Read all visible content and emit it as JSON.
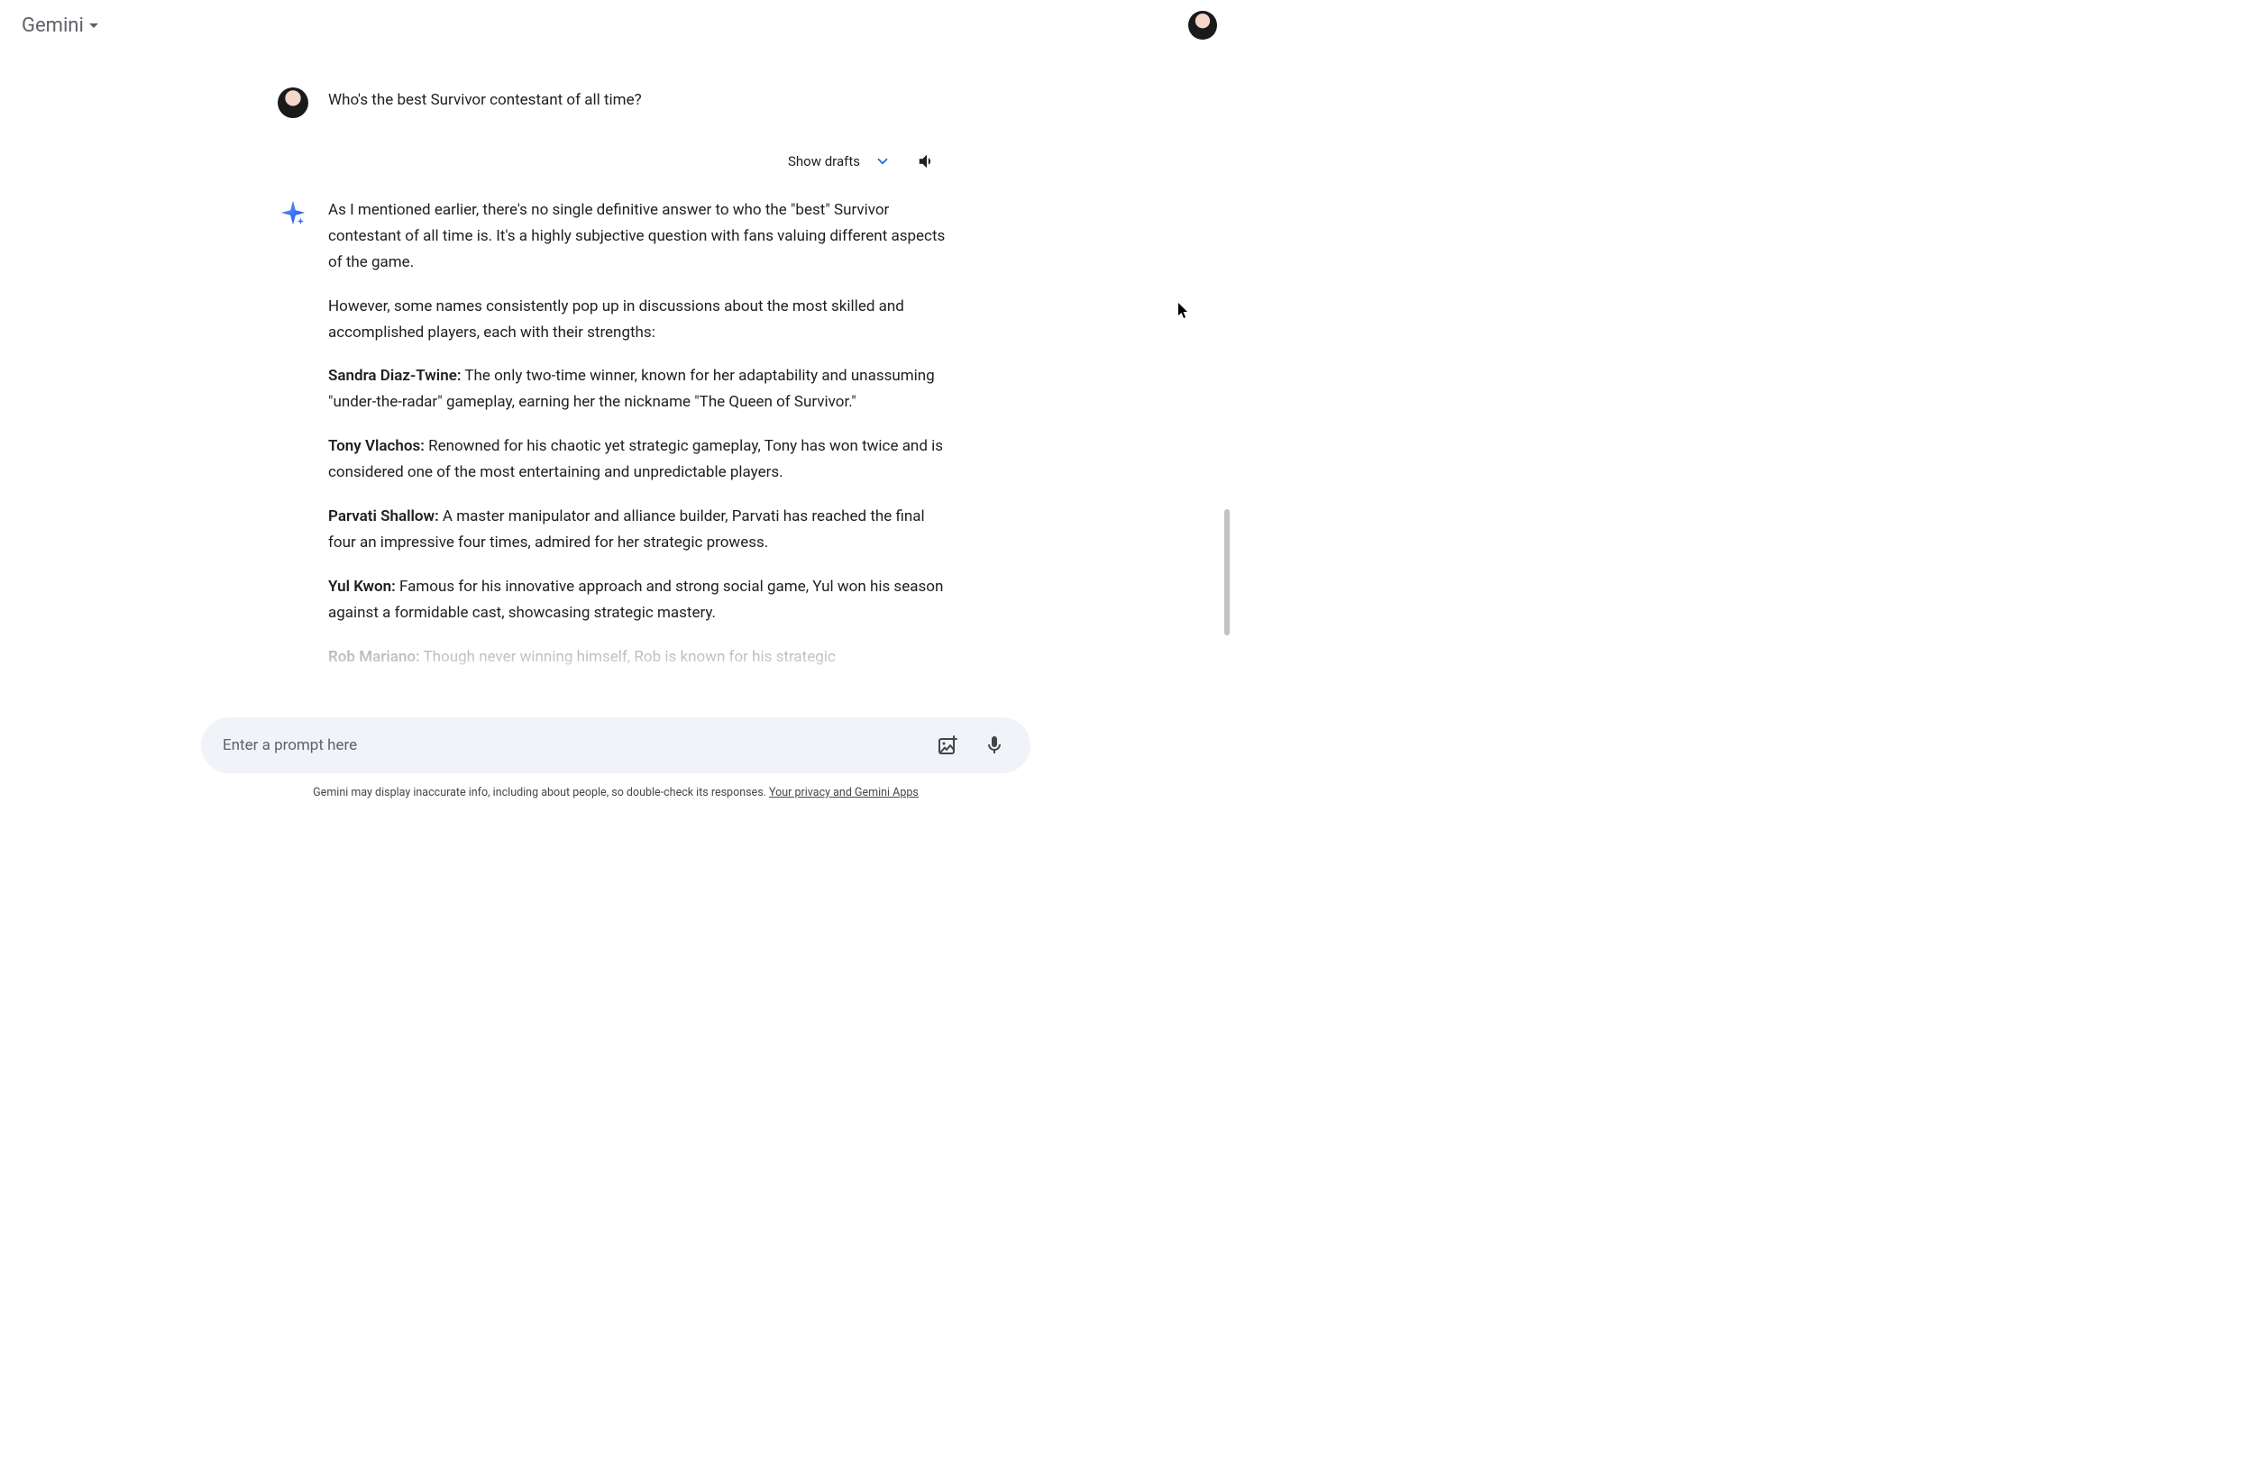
{
  "header": {
    "model_name": "Gemini"
  },
  "conversation": {
    "user_prompt": "Who's the best Survivor contestant of all time?",
    "drafts_label": "Show drafts",
    "response": {
      "intro1": "As I mentioned earlier, there's no single definitive answer to who the \"best\" Survivor contestant of all time is. It's a highly subjective question with fans valuing different aspects of the game.",
      "intro2": "However, some names consistently pop up in discussions about the most skilled and accomplished players, each with their strengths:",
      "players": [
        {
          "name": "Sandra Diaz-Twine:",
          "desc": " The only two-time winner, known for her adaptability and unassuming \"under-the-radar\" gameplay, earning her the nickname \"The Queen of Survivor.\""
        },
        {
          "name": "Tony Vlachos:",
          "desc": " Renowned for his chaotic yet strategic gameplay, Tony has won twice and is considered one of the most entertaining and unpredictable players."
        },
        {
          "name": "Parvati Shallow:",
          "desc": " A master manipulator and alliance builder, Parvati has reached the final four an impressive four times, admired for her strategic prowess."
        },
        {
          "name": "Yul Kwon:",
          "desc": " Famous for his innovative approach and strong social game, Yul won his season against a formidable cast, showcasing strategic mastery."
        },
        {
          "name": "Rob Mariano:",
          "desc": " Though never winning himself, Rob is known for his strategic"
        }
      ]
    }
  },
  "input": {
    "placeholder": "Enter a prompt here"
  },
  "footer": {
    "disclaimer_text": "Gemini may display inaccurate info, including about people, so double-check its responses. ",
    "disclaimer_link": "Your privacy and Gemini Apps"
  }
}
